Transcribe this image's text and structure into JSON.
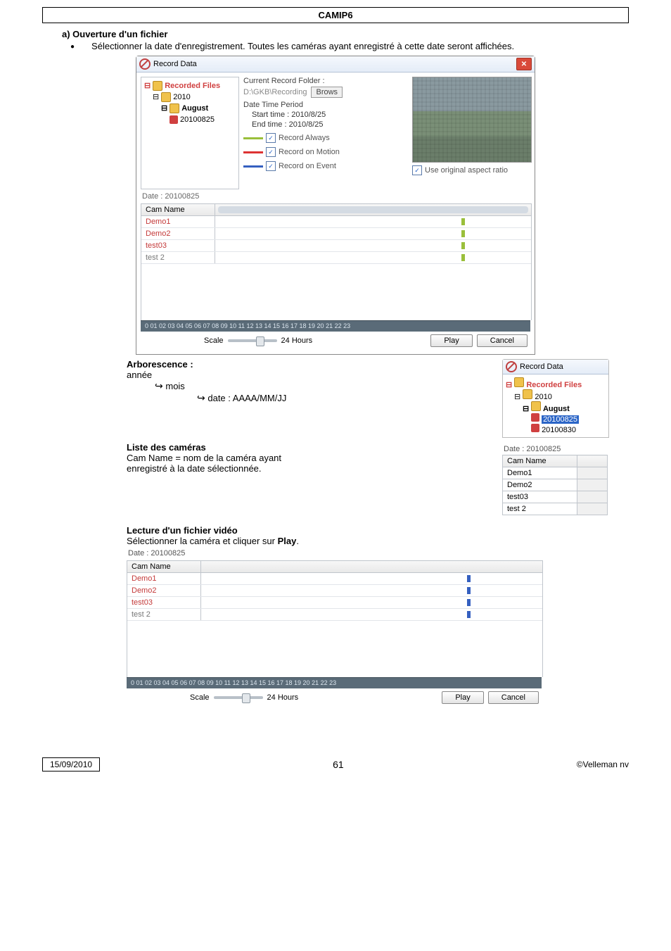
{
  "header": "CAMIP6",
  "section_a": {
    "title": "a) Ouverture d'un fichier",
    "bullet": "Sélectionner la date d'enregistrement. Toutes les caméras ayant enregistré à cette date seront affichées."
  },
  "record_window": {
    "title": "Record Data",
    "tree": {
      "root": "Recorded Files",
      "year": "2010",
      "month": "August",
      "date": "20100825"
    },
    "current_folder_label": "Current Record Folder :",
    "folder_path": "D:\\GKB\\Recording",
    "browse_btn": "Brows",
    "date_period_label": "Date Time Period",
    "start_time_label": "Start time :",
    "start_time_value": "2010/8/25",
    "end_time_label": "End time :",
    "end_time_value": "2010/8/25",
    "chk_always": "Record Always",
    "chk_motion": "Record on Motion",
    "chk_event": "Record on Event",
    "use_aspect": "Use original aspect ratio",
    "date_label": "Date :",
    "date_value": "20100825",
    "cam_header": "Cam Name",
    "cams": [
      "Demo1",
      "Demo2",
      "test03",
      "test 2"
    ],
    "ruler": "0  01  02  03  04  05  06  07  08  09  10  11  12  13  14  15  16  17  18  19  20  21  22  23",
    "scale_label": "Scale",
    "scale_value": "24 Hours",
    "play_btn": "Play",
    "cancel_btn": "Cancel"
  },
  "arbo": {
    "title": "Arborescence :",
    "l1": "année",
    "l2_pre": "↳",
    "l2": "mois",
    "l3_pre": "↳",
    "l3": "date : AAAA/MM/JJ"
  },
  "mini_tree": {
    "title": "Record Data",
    "root": "Recorded Files",
    "year": "2010",
    "month": "August",
    "d1": "20100825",
    "d2": "20100830"
  },
  "liste_cam": {
    "title": "Liste des caméras",
    "desc1": "Cam Name = nom de la caméra ayant",
    "desc2": "enregistré à la date sélectionnée."
  },
  "cam_list_box": {
    "date_label": "Date :",
    "date_value": "20100825",
    "header": "Cam Name",
    "rows": [
      "Demo1",
      "Demo2",
      "test03",
      "test 2"
    ]
  },
  "lecture": {
    "title": "Lecture d'un fichier vidéo",
    "desc_pre": "Sélectionner la caméra et cliquer sur ",
    "desc_bold": "Play",
    "desc_post": "."
  },
  "timeline2": {
    "date_label": "Date :",
    "date_value": "20100825",
    "cam_header": "Cam Name",
    "cams": [
      "Demo1",
      "Demo2",
      "test03",
      "test 2"
    ],
    "ruler": "0  01  02  03  04  05  06  07  08  09  10  11  12  13  14  15  16  17  18  19  20  21  22  23",
    "scale_label": "Scale",
    "scale_value": "24 Hours",
    "play_btn": "Play",
    "cancel_btn": "Cancel"
  },
  "footer": {
    "date": "15/09/2010",
    "page": "61",
    "copy": "©Velleman nv"
  }
}
